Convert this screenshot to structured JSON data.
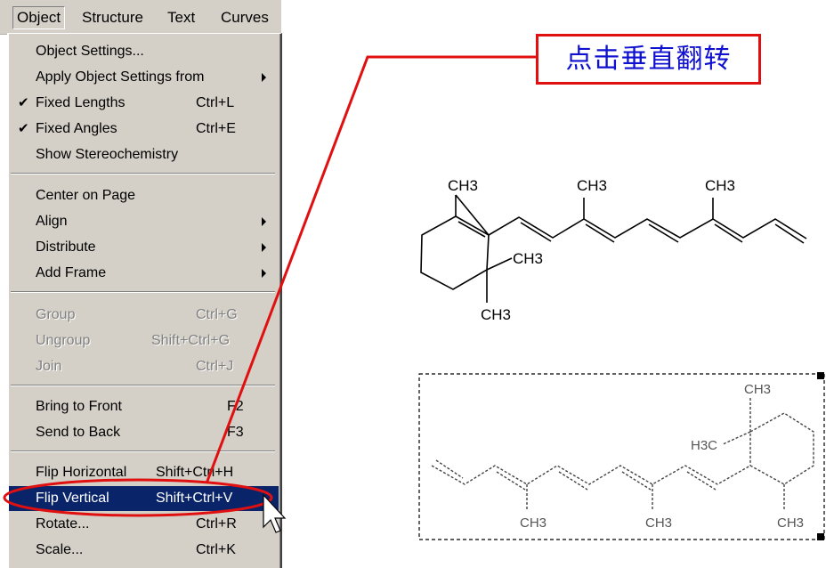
{
  "menubar": {
    "items": [
      {
        "label": "Object"
      },
      {
        "label": "Structure"
      },
      {
        "label": "Text"
      },
      {
        "label": "Curves"
      }
    ]
  },
  "menu": {
    "object_settings": {
      "label": "Object Settings..."
    },
    "apply_settings": {
      "label": "Apply Object Settings from"
    },
    "fixed_lengths": {
      "label": "Fixed Lengths",
      "shortcut": "Ctrl+L",
      "checked": true
    },
    "fixed_angles": {
      "label": "Fixed Angles",
      "shortcut": "Ctrl+E",
      "checked": true
    },
    "show_stereo": {
      "label": "Show Stereochemistry"
    },
    "center_on_page": {
      "label": "Center on Page"
    },
    "align": {
      "label": "Align"
    },
    "distribute": {
      "label": "Distribute"
    },
    "add_frame": {
      "label": "Add Frame"
    },
    "group": {
      "label": "Group",
      "shortcut": "Ctrl+G"
    },
    "ungroup": {
      "label": "Ungroup",
      "shortcut": "Shift+Ctrl+G"
    },
    "join": {
      "label": "Join",
      "shortcut": "Ctrl+J"
    },
    "bring_to_front": {
      "label": "Bring to Front",
      "shortcut": "F2"
    },
    "send_to_back": {
      "label": "Send to Back",
      "shortcut": "F3"
    },
    "flip_horizontal": {
      "label": "Flip Horizontal",
      "shortcut": "Shift+Ctrl+H"
    },
    "flip_vertical": {
      "label": "Flip Vertical",
      "shortcut": "Shift+Ctrl+V"
    },
    "rotate": {
      "label": "Rotate...",
      "shortcut": "Ctrl+R"
    },
    "scale": {
      "label": "Scale...",
      "shortcut": "Ctrl+K"
    }
  },
  "callout": {
    "text": "点击垂直翻转"
  },
  "molecule_top": {
    "labels": [
      "CH3",
      "CH3",
      "CH3",
      "CH3",
      "CH3"
    ]
  },
  "molecule_bottom": {
    "labels": [
      "CH3",
      "H3C",
      "CH3",
      "CH3",
      "CH3"
    ]
  },
  "colors": {
    "highlight": "#0a246a",
    "annotation": "#e01010",
    "callout_text": "#1010d0",
    "menu_bg": "#d4d0c8"
  },
  "icons": [
    "checkmark-icon",
    "submenu-arrow-icon",
    "mouse-cursor-icon"
  ]
}
